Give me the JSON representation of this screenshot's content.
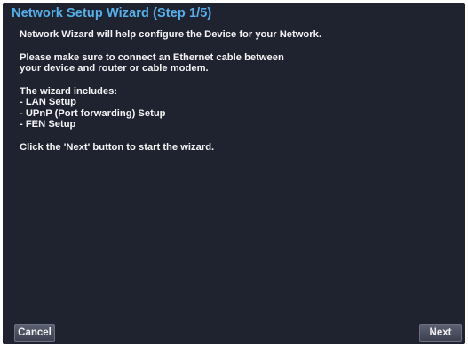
{
  "dialog": {
    "title": "Network Setup Wizard (Step 1/5)",
    "intro": "Network Wizard will help configure the Device for your Network.",
    "cable_notice": [
      "Please make sure to connect an Ethernet cable between",
      "your device and router or cable modem."
    ],
    "includes_heading": "The wizard includes:",
    "includes_items": [
      "- LAN Setup",
      "- UPnP (Port forwarding) Setup",
      "- FEN Setup"
    ],
    "start_hint": "Click the 'Next' button to start the wizard."
  },
  "buttons": {
    "cancel_label": "Cancel",
    "next_label": "Next"
  },
  "colors": {
    "background": "#1f2330",
    "title": "#54b0ea",
    "text": "#f4f4f4"
  }
}
